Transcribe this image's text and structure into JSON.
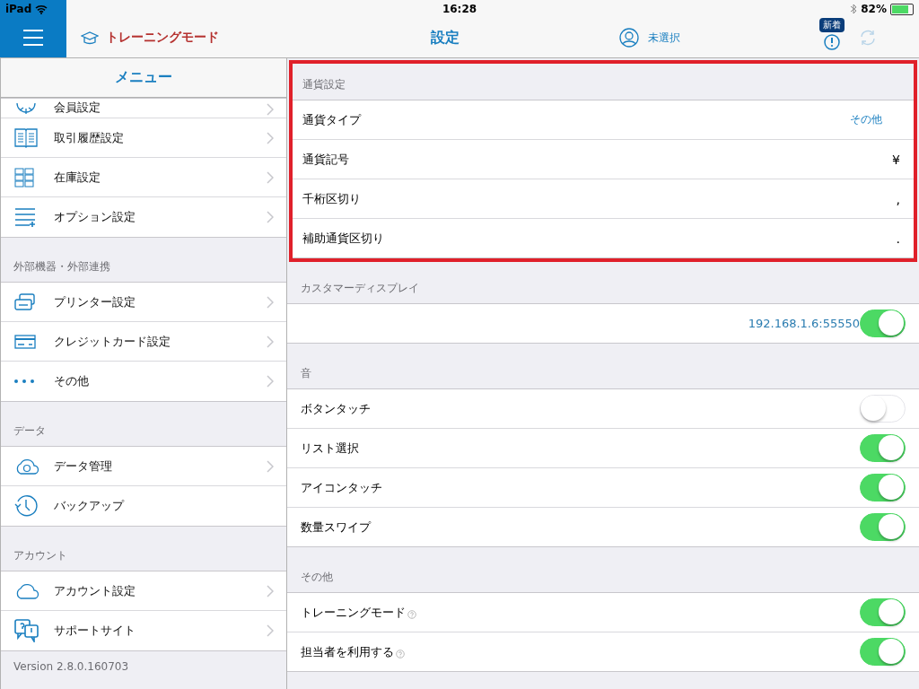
{
  "status_bar": {
    "carrier": "iPad",
    "time": "16:28",
    "battery": "82%"
  },
  "nav": {
    "mode": "トレーニングモード",
    "title": "設定",
    "staff": "未選択",
    "badge": "新着"
  },
  "sidebar": {
    "title": "メニュー",
    "sections": [
      {
        "items": [
          {
            "label": "会員設定",
            "chevron": true
          },
          {
            "label": "取引履歴設定",
            "chevron": true
          },
          {
            "label": "在庫設定",
            "chevron": true
          },
          {
            "label": "オプション設定",
            "chevron": true
          }
        ]
      },
      {
        "header": "外部機器・外部連携",
        "items": [
          {
            "label": "プリンター設定",
            "chevron": true
          },
          {
            "label": "クレジットカード設定",
            "chevron": true
          },
          {
            "label": "その他",
            "chevron": true
          }
        ]
      },
      {
        "header": "データ",
        "items": [
          {
            "label": "データ管理",
            "chevron": true
          },
          {
            "label": "バックアップ",
            "chevron": false
          }
        ]
      },
      {
        "header": "アカウント",
        "items": [
          {
            "label": "アカウント設定",
            "chevron": true
          },
          {
            "label": "サポートサイト",
            "chevron": true
          }
        ]
      }
    ],
    "version": "Version 2.8.0.160703"
  },
  "settings": [
    {
      "header": "通貨設定",
      "highlighted": true,
      "rows": [
        {
          "kind": "value",
          "label": "通貨タイプ",
          "value": "その他",
          "link": true
        },
        {
          "kind": "value",
          "label": "通貨記号",
          "value": "¥",
          "link": false
        },
        {
          "kind": "value",
          "label": "千桁区切り",
          "value": ",",
          "link": false
        },
        {
          "kind": "value",
          "label": "補助通貨区切り",
          "value": ".",
          "link": false
        }
      ]
    },
    {
      "header": "カスタマーディスプレイ",
      "highlighted": false,
      "rows": [
        {
          "kind": "toggle",
          "value": "192.168.1.6:55550",
          "on": true,
          "help": false
        }
      ]
    },
    {
      "header": "音",
      "highlighted": false,
      "rows": [
        {
          "kind": "toggle",
          "label": "ボタンタッチ",
          "on": false,
          "help": false
        },
        {
          "kind": "toggle",
          "label": "リスト選択",
          "on": true,
          "help": false
        },
        {
          "kind": "toggle",
          "label": "アイコンタッチ",
          "on": true,
          "help": false
        },
        {
          "kind": "toggle",
          "label": "数量スワイプ",
          "on": true,
          "help": false
        }
      ]
    },
    {
      "header": "その他",
      "highlighted": false,
      "rows": [
        {
          "kind": "toggle",
          "label": "トレーニングモード",
          "on": true,
          "help": true
        },
        {
          "kind": "toggle",
          "label": "担当者を利用する",
          "on": true,
          "help": true
        }
      ]
    }
  ]
}
